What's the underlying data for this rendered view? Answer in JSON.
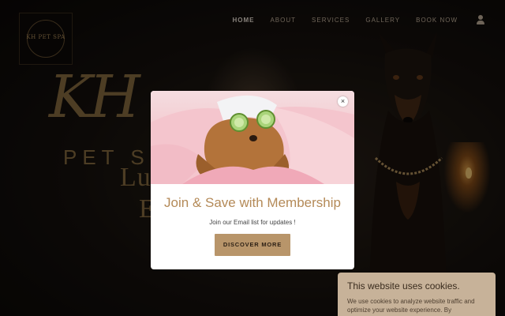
{
  "brand": {
    "logo_text": "KH PET SPA",
    "hero_mark": "KH",
    "hero_sub": "PET SP",
    "hero_tagline_1": "Lu                          lm",
    "hero_tagline_2": "E                                e."
  },
  "nav": {
    "items": [
      "HOME",
      "ABOUT",
      "SERVICES",
      "GALLERY",
      "BOOK NOW"
    ],
    "active": "HOME"
  },
  "modal": {
    "title": "Join & Save with Membership",
    "subtitle": "Join our Email list for updates !",
    "cta_label": "DISCOVER MORE",
    "close_symbol": "×"
  },
  "cookie": {
    "title": "This website uses cookies.",
    "body": "We use cookies to analyze website traffic and optimize your website experience. By"
  },
  "colors": {
    "accent": "#b8956a",
    "modal_title": "#b48a58",
    "cookie_bg": "#c7b299"
  }
}
